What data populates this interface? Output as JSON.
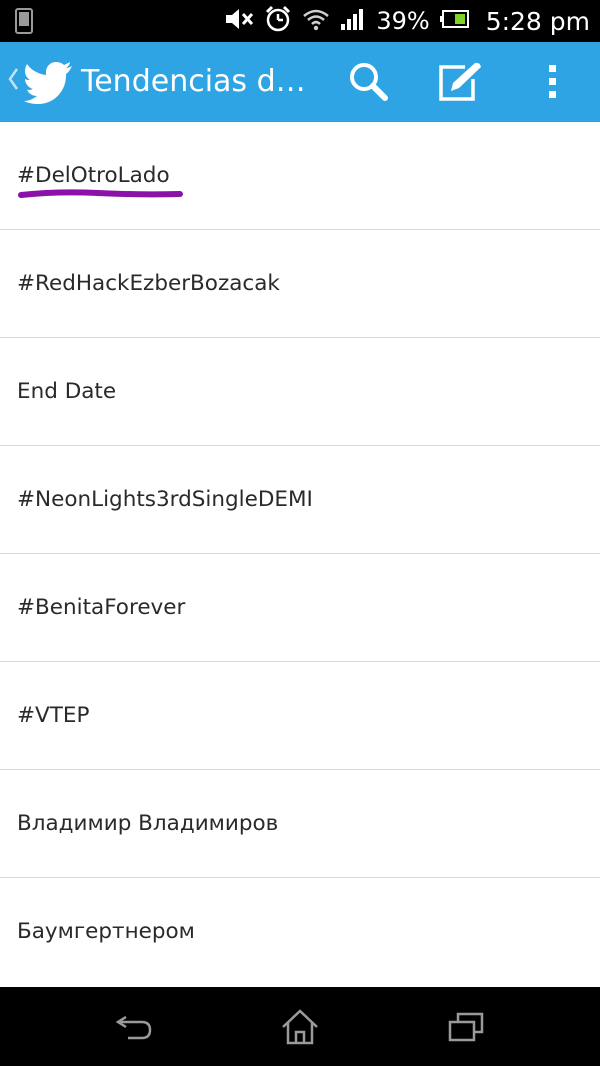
{
  "status_bar": {
    "battery_percent": "39%",
    "time": "5:28 pm",
    "icons": [
      "phone-icon",
      "mute-icon",
      "alarm-icon",
      "wifi-icon",
      "signal-icon",
      "battery-icon"
    ]
  },
  "action_bar": {
    "title": "Tendencias d…",
    "icons": [
      "back-chevron-icon",
      "twitter-bird-icon",
      "search-icon",
      "compose-icon",
      "overflow-menu-icon"
    ],
    "color": "#2fa4e4"
  },
  "trends": [
    {
      "label": "#DelOtroLado"
    },
    {
      "label": "#RedHackEzberBozacak"
    },
    {
      "label": "End Date"
    },
    {
      "label": "#NeonLights3rdSingleDEMI"
    },
    {
      "label": "#BenitaForever"
    },
    {
      "label": "#VTEP"
    },
    {
      "label": "Владимир Владимиров"
    },
    {
      "label": "Баумгертнером"
    }
  ],
  "annotation_color": "#8b11a8",
  "nav_bar": {
    "icons": [
      "back-icon",
      "home-icon",
      "recent-apps-icon"
    ]
  }
}
